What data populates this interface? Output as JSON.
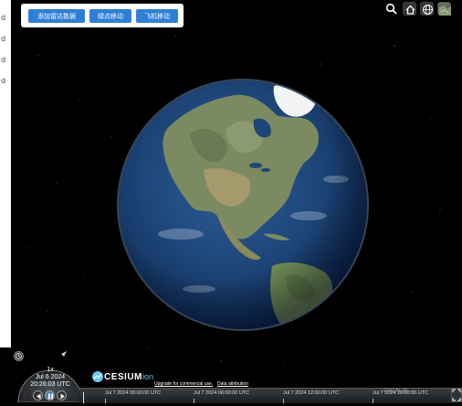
{
  "toolbar": {
    "buttons": [
      {
        "label": "添加雷达数据"
      },
      {
        "label": "绿点移动"
      },
      {
        "label": "飞机移动"
      }
    ]
  },
  "viewer_toolbar": {
    "icons": [
      "search-icon",
      "home-icon",
      "globe-icon",
      "base-layer-icon"
    ]
  },
  "left_strip": {
    "chars": [
      "d",
      "d",
      "d",
      "d"
    ]
  },
  "animation": {
    "speed": "1x",
    "date": "Jul 6 2024",
    "time": "20:26:03 UTC"
  },
  "credits": {
    "logo_text": "CESIUM",
    "logo_suffix": "ion",
    "upgrade_link": "Upgrade for commercial use.",
    "attribution_link": "Data attribution"
  },
  "timeline": {
    "labels": [
      "Jul 7 2024 00:00:00 UTC",
      "Jul 7 2024 06:00:00 UTC",
      "Jul 7 2024 12:00:00 UTC",
      "Jul 7 2024 18:00:00 UTC"
    ]
  },
  "watermark": "CSDN @..."
}
